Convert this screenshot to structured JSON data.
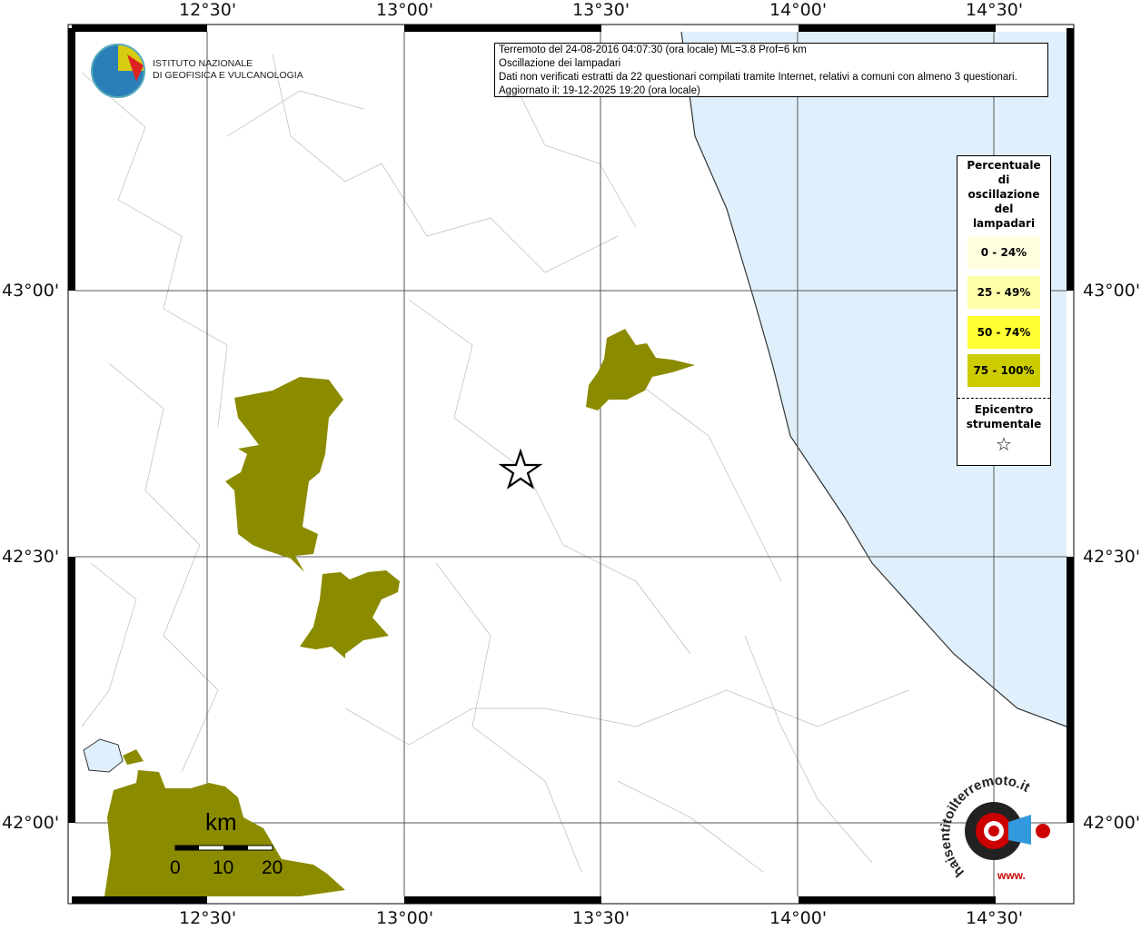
{
  "info": {
    "line1": "Terremoto del 24-08-2016 04:07:30 (ora locale) ML=3.8 Prof=6 km",
    "line2": "Oscillazione dei lampadari",
    "line3": "Dati non verificati estratti da 22 questionari compilati tramite Internet, relativi a comuni con almeno 3 questionari.",
    "line4": "Aggiornato il: 19-12-2025 19:20 (ora locale)"
  },
  "logo": {
    "line1": "ISTITUTO NAZIONALE",
    "line2": "DI GEOFISICA E VULCANOLOGIA"
  },
  "legend": {
    "title": [
      "Percentuale",
      "di",
      "oscillazione",
      "del",
      "lampadari"
    ],
    "classes": [
      {
        "label": "0 - 24%",
        "color": "#ffffe0"
      },
      {
        "label": "25 - 49%",
        "color": "#ffffaa"
      },
      {
        "label": "50 - 74%",
        "color": "#ffff33"
      },
      {
        "label": "75 - 100%",
        "color": "#cccc00"
      }
    ],
    "epicentre": [
      "Epicentro",
      "strumentale"
    ]
  },
  "axes": {
    "lon": [
      "12°30'",
      "13°00'",
      "13°30'",
      "14°00'",
      "14°30'"
    ],
    "lat": [
      "43°00'",
      "42°30'",
      "42°00'"
    ]
  },
  "scale": {
    "unit": "km",
    "ticks": [
      "0",
      "10",
      "20"
    ]
  },
  "colors": {
    "sea": "#dff0fc",
    "filled": "#8b8b00"
  },
  "badge": {
    "text": "haisentitoilterremoto.it",
    "www": "www."
  }
}
